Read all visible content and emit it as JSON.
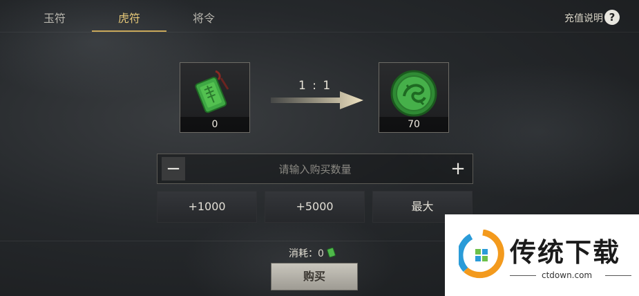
{
  "tabs": [
    {
      "label": "玉符",
      "active": false
    },
    {
      "label": "虎符",
      "active": true
    },
    {
      "label": "将令",
      "active": false
    }
  ],
  "help": {
    "label": "充值说明",
    "icon": "?"
  },
  "exchange": {
    "source": {
      "icon": "jade-token-icon",
      "count": "0"
    },
    "ratio": "1 : 1",
    "target": {
      "icon": "tiger-seal-coin-icon",
      "count": "70"
    }
  },
  "quantity": {
    "placeholder": "请输入购买数量",
    "value": "",
    "minus": "−",
    "plus": "+"
  },
  "quick_buttons": [
    "+1000",
    "+5000",
    "最大"
  ],
  "cost": {
    "label": "消耗：",
    "value": "0",
    "icon": "jade-token-icon"
  },
  "buy_label": "购买",
  "watermark": {
    "title": "传统下载",
    "subtitle": "ctdown.com"
  },
  "colors": {
    "accent": "#e6c878",
    "jade": "#4fb84a"
  }
}
